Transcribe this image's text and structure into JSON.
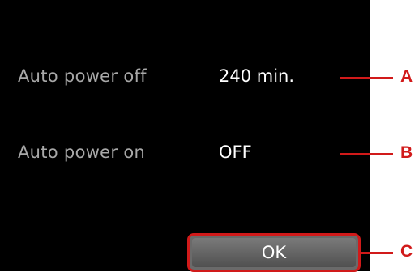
{
  "settings": {
    "rows": [
      {
        "label": "Auto power off",
        "value": "240 min."
      },
      {
        "label": "Auto power on",
        "value": "OFF"
      }
    ],
    "ok_label": "OK"
  },
  "callouts": [
    "A",
    "B",
    "C"
  ],
  "colors": {
    "screen_bg": "#000000",
    "label_text": "#a8a8a8",
    "value_text": "#ffffff",
    "callout_red": "#d11a1a"
  }
}
